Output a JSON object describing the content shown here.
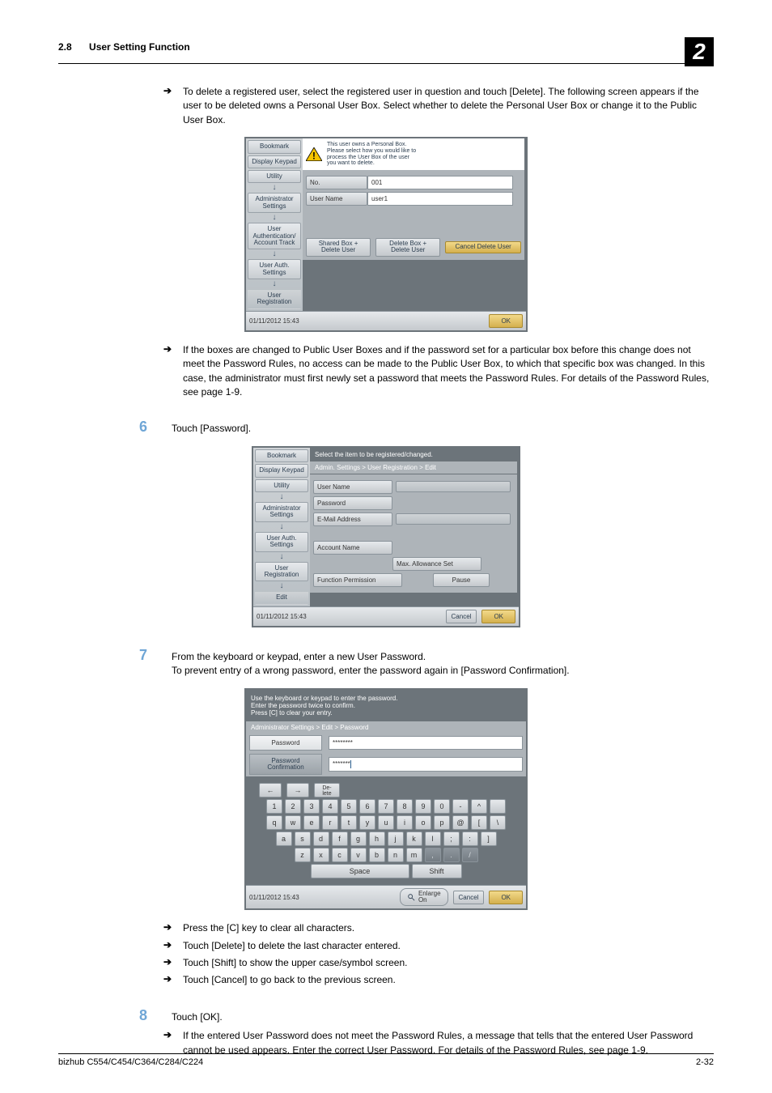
{
  "header": {
    "section_number": "2.8",
    "section_title": "User Setting Function",
    "chapter_badge": "2"
  },
  "body": {
    "arrow1": "To delete a registered user, select the registered user in question and touch [Delete]. The following screen appears if the user to be deleted owns a Personal User Box. Select whether to delete the Personal User Box or change it to the Public User Box.",
    "arrow2": "If the boxes are changed to Public User Boxes and if the password set for a particular box before this change does not meet the Password Rules, no access can be made to the Public User Box, to which that specific box was changed. In this case, the administrator must first newly set a password that meets the Password Rules. For details of the Password Rules, see page 1-9.",
    "step6_num": "6",
    "step6_txt": "Touch [Password].",
    "step7_num": "7",
    "step7_txt": "From the keyboard or keypad, enter a new User Password.\nTo prevent entry of a wrong password, enter the password again in [Password Confirmation].",
    "tips": {
      "a": "Press the [C] key to clear all characters.",
      "b": "Touch [Delete] to delete the last character entered.",
      "c": "Touch [Shift] to show the upper case/symbol screen.",
      "d": "Touch [Cancel] to go back to the previous screen."
    },
    "step8_num": "8",
    "step8_txt": "Touch [OK].",
    "arrow3": "If the entered User Password does not meet the Password Rules, a message that tells that the entered User Password cannot be used appears. Enter the correct User Password. For details of the Password Rules, see page 1-9."
  },
  "fig1": {
    "left": {
      "bookmark": "Bookmark",
      "display_keypad": "Display Keypad",
      "utility": "Utility",
      "admin": "Administrator\nSettings",
      "uap": "User\nAuthentication/\nAccount Track",
      "ua": "User Auth.\nSettings",
      "ur": "User\nRegistration"
    },
    "warn": "This user owns a Personal Box.\nPlease select how you would like to\nprocess the User Box of the user\nyou want to delete.",
    "no_label": "No.",
    "no_value": "001",
    "name_label": "User Name",
    "name_value": "user1",
    "btn_shared": "Shared Box +\nDelete User",
    "btn_delete": "Delete Box +\nDelete User",
    "btn_cancel": "Cancel Delete User",
    "datetime": "01/11/2012   15:43",
    "ok": "OK"
  },
  "fig2": {
    "left": {
      "bookmark": "Bookmark",
      "display_keypad": "Display Keypad",
      "utility": "Utility",
      "admin": "Administrator\nSettings",
      "ua": "User Auth.\nSettings",
      "ur": "User\nRegistration",
      "edit": "Edit"
    },
    "top_msg": "Select the item to be registered/changed.",
    "breadcrumb": "Admin. Settings > User Registration > Edit",
    "fields": {
      "user_name": "User Name",
      "password": "Password",
      "email": "E-Mail Address",
      "account": "Account Name",
      "max": "Max. Allowance Set",
      "func": "Function Permission",
      "pause": "Pause"
    },
    "datetime": "01/11/2012   15:43",
    "cancel": "Cancel",
    "ok": "OK"
  },
  "fig3": {
    "top_msg": "Use the keyboard or keypad to enter the password.\nEnter the password twice to confirm.\nPress [C] to clear your entry.",
    "breadcrumb": "Administrator Settings > Edit > Password",
    "tab_password": "Password",
    "tab_confirm": "Password\nConfirmation",
    "pw_value": "********",
    "pw_confirm_value": "*******",
    "keys_nav": {
      "left": "←",
      "right": "→",
      "delete": "De-\nlete"
    },
    "rows": {
      "r1": [
        "1",
        "2",
        "3",
        "4",
        "5",
        "6",
        "7",
        "8",
        "9",
        "0",
        "-",
        "^",
        " "
      ],
      "r2": [
        "q",
        "w",
        "e",
        "r",
        "t",
        "y",
        "u",
        "i",
        "o",
        "p",
        "@",
        "[",
        "\\"
      ],
      "r3": [
        "a",
        "s",
        "d",
        "f",
        "g",
        "h",
        "j",
        "k",
        "l",
        ";",
        ":",
        "]"
      ],
      "r4": [
        "z",
        "x",
        "c",
        "v",
        "b",
        "n",
        "m",
        ",",
        ".",
        "/"
      ]
    },
    "space": "Space",
    "shift": "Shift",
    "enlarge": "Enlarge\nOn",
    "datetime": "01/11/2012   15:43",
    "cancel": "Cancel",
    "ok": "OK"
  },
  "footer": {
    "model": "bizhub C554/C454/C364/C284/C224",
    "page": "2-32"
  }
}
